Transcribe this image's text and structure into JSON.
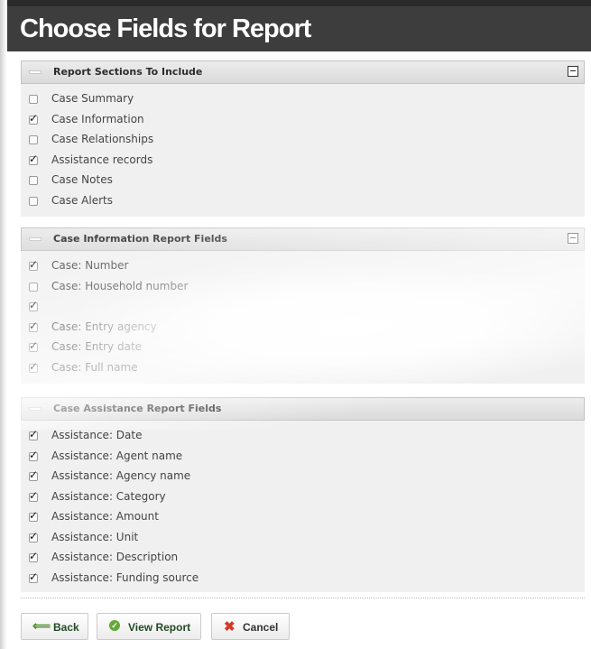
{
  "page": {
    "title": "Choose Fields for Report"
  },
  "panels": [
    {
      "title": "Report Sections To Include",
      "collapsible": true,
      "items": [
        {
          "label": "Case Summary",
          "checked": false
        },
        {
          "label": "Case Information",
          "checked": true
        },
        {
          "label": "Case Relationships",
          "checked": false
        },
        {
          "label": "Assistance records",
          "checked": true
        },
        {
          "label": "Case Notes",
          "checked": false
        },
        {
          "label": "Case Alerts",
          "checked": false
        }
      ]
    },
    {
      "title": "Case Information Report Fields",
      "collapsible": true,
      "items": [
        {
          "label": "Case: Number",
          "checked": true
        },
        {
          "label": "Case: Household number",
          "checked": false
        },
        {
          "label": "",
          "checked": true
        },
        {
          "label": "Case: Entry agency",
          "checked": true
        },
        {
          "label": "Case: Entry date",
          "checked": true
        },
        {
          "label": "Case: Full name",
          "checked": true
        }
      ]
    },
    {
      "title": "Case Assistance Report Fields",
      "collapsible": false,
      "items": [
        {
          "label": "Assistance: Date",
          "checked": true
        },
        {
          "label": "Assistance: Agent name",
          "checked": true
        },
        {
          "label": "Assistance: Agency name",
          "checked": true
        },
        {
          "label": "Assistance: Category",
          "checked": true
        },
        {
          "label": "Assistance: Amount",
          "checked": true
        },
        {
          "label": "Assistance: Unit",
          "checked": true
        },
        {
          "label": "Assistance: Description",
          "checked": true
        },
        {
          "label": "Assistance: Funding source",
          "checked": true
        }
      ]
    }
  ],
  "buttons": {
    "back": {
      "label": "Back",
      "icon": "arrow-left-icon"
    },
    "view_report": {
      "label": "View Report",
      "icon": "check-circle-icon"
    },
    "cancel": {
      "label": "Cancel",
      "icon": "x-icon"
    }
  },
  "colors": {
    "title_bar": "#3d3d3d",
    "panel_bg": "#f0f0f0",
    "button_text": "#224a25",
    "cancel_icon": "#d43a2a",
    "ok_icon": "#66a83a"
  }
}
